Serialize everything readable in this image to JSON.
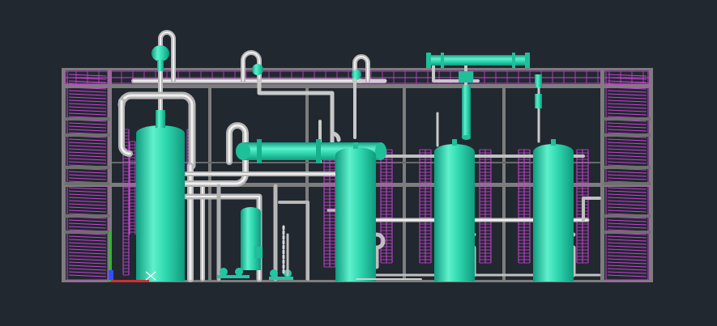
{
  "viewport": {
    "background": "#212830",
    "label": ""
  },
  "colors": {
    "frame": "#808080",
    "frame_light": "#a8a8a8",
    "pipe": "#d6d6d6",
    "pipe_shadow": "#9a9a9a",
    "vessel": "#2fd9b0",
    "vessel_dark": "#14a98a",
    "vessel_light": "#7ff0d2",
    "handrail": "#d040d8",
    "ladder": "#c838d0",
    "ucs_x": "#e03030",
    "ucs_y": "#30c030",
    "ucs_z": "#3050ff"
  },
  "icons": {
    "ucs": "ucs-axis-icon"
  }
}
